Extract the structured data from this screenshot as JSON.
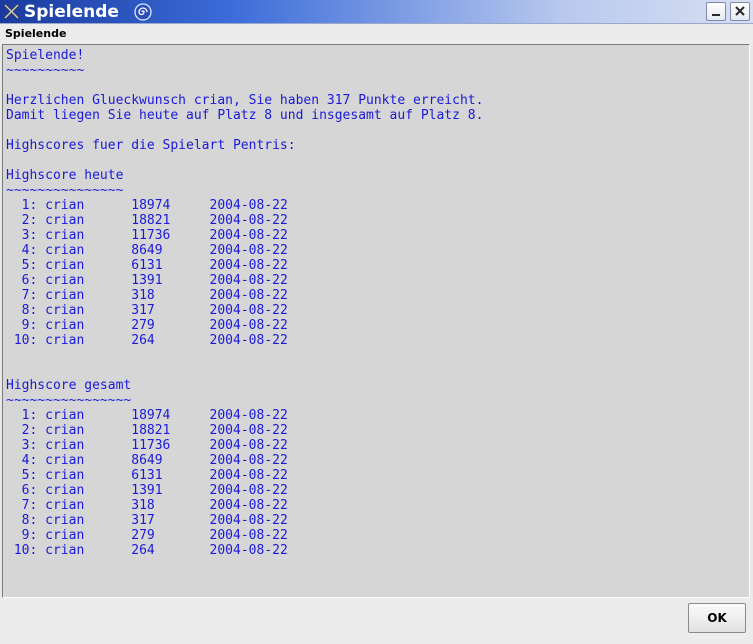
{
  "window": {
    "title": "Spielende",
    "sys_icon": "x-logo-icon",
    "app_icon": "spiral-app-icon"
  },
  "menubar": {
    "label": "Spielende"
  },
  "content": {
    "heading": "Spielende!",
    "heading_rule": "~~~~~~~~~~",
    "congrats_line1": "Herzlichen Glueckwunsch crian, Sie haben 317 Punkte erreicht.",
    "congrats_line2": "Damit liegen Sie heute auf Platz 8 und insgesamt auf Platz 8.",
    "highscores_intro": "Highscores fuer die Spielart Pentris:",
    "sections": [
      {
        "title": "Highscore heute",
        "rule": "~~~~~~~~~~~~~~~",
        "rows": [
          {
            "rank": "1:",
            "name": "crian",
            "score": "18974",
            "date": "2004-08-22"
          },
          {
            "rank": "2:",
            "name": "crian",
            "score": "18821",
            "date": "2004-08-22"
          },
          {
            "rank": "3:",
            "name": "crian",
            "score": "11736",
            "date": "2004-08-22"
          },
          {
            "rank": "4:",
            "name": "crian",
            "score": "8649",
            "date": "2004-08-22"
          },
          {
            "rank": "5:",
            "name": "crian",
            "score": "6131",
            "date": "2004-08-22"
          },
          {
            "rank": "6:",
            "name": "crian",
            "score": "1391",
            "date": "2004-08-22"
          },
          {
            "rank": "7:",
            "name": "crian",
            "score": "318",
            "date": "2004-08-22"
          },
          {
            "rank": "8:",
            "name": "crian",
            "score": "317",
            "date": "2004-08-22"
          },
          {
            "rank": "9:",
            "name": "crian",
            "score": "279",
            "date": "2004-08-22"
          },
          {
            "rank": "10:",
            "name": "crian",
            "score": "264",
            "date": "2004-08-22"
          }
        ]
      },
      {
        "title": "Highscore gesamt",
        "rule": "~~~~~~~~~~~~~~~~",
        "rows": [
          {
            "rank": "1:",
            "name": "crian",
            "score": "18974",
            "date": "2004-08-22"
          },
          {
            "rank": "2:",
            "name": "crian",
            "score": "18821",
            "date": "2004-08-22"
          },
          {
            "rank": "3:",
            "name": "crian",
            "score": "11736",
            "date": "2004-08-22"
          },
          {
            "rank": "4:",
            "name": "crian",
            "score": "8649",
            "date": "2004-08-22"
          },
          {
            "rank": "5:",
            "name": "crian",
            "score": "6131",
            "date": "2004-08-22"
          },
          {
            "rank": "6:",
            "name": "crian",
            "score": "1391",
            "date": "2004-08-22"
          },
          {
            "rank": "7:",
            "name": "crian",
            "score": "318",
            "date": "2004-08-22"
          },
          {
            "rank": "8:",
            "name": "crian",
            "score": "317",
            "date": "2004-08-22"
          },
          {
            "rank": "9:",
            "name": "crian",
            "score": "279",
            "date": "2004-08-22"
          },
          {
            "rank": "10:",
            "name": "crian",
            "score": "264",
            "date": "2004-08-22"
          }
        ]
      }
    ]
  },
  "buttons": {
    "ok_label": "OK"
  },
  "colors": {
    "text": "#1a1ad8",
    "title_text": "#ffffff",
    "content_bg": "#d6d6d6"
  }
}
